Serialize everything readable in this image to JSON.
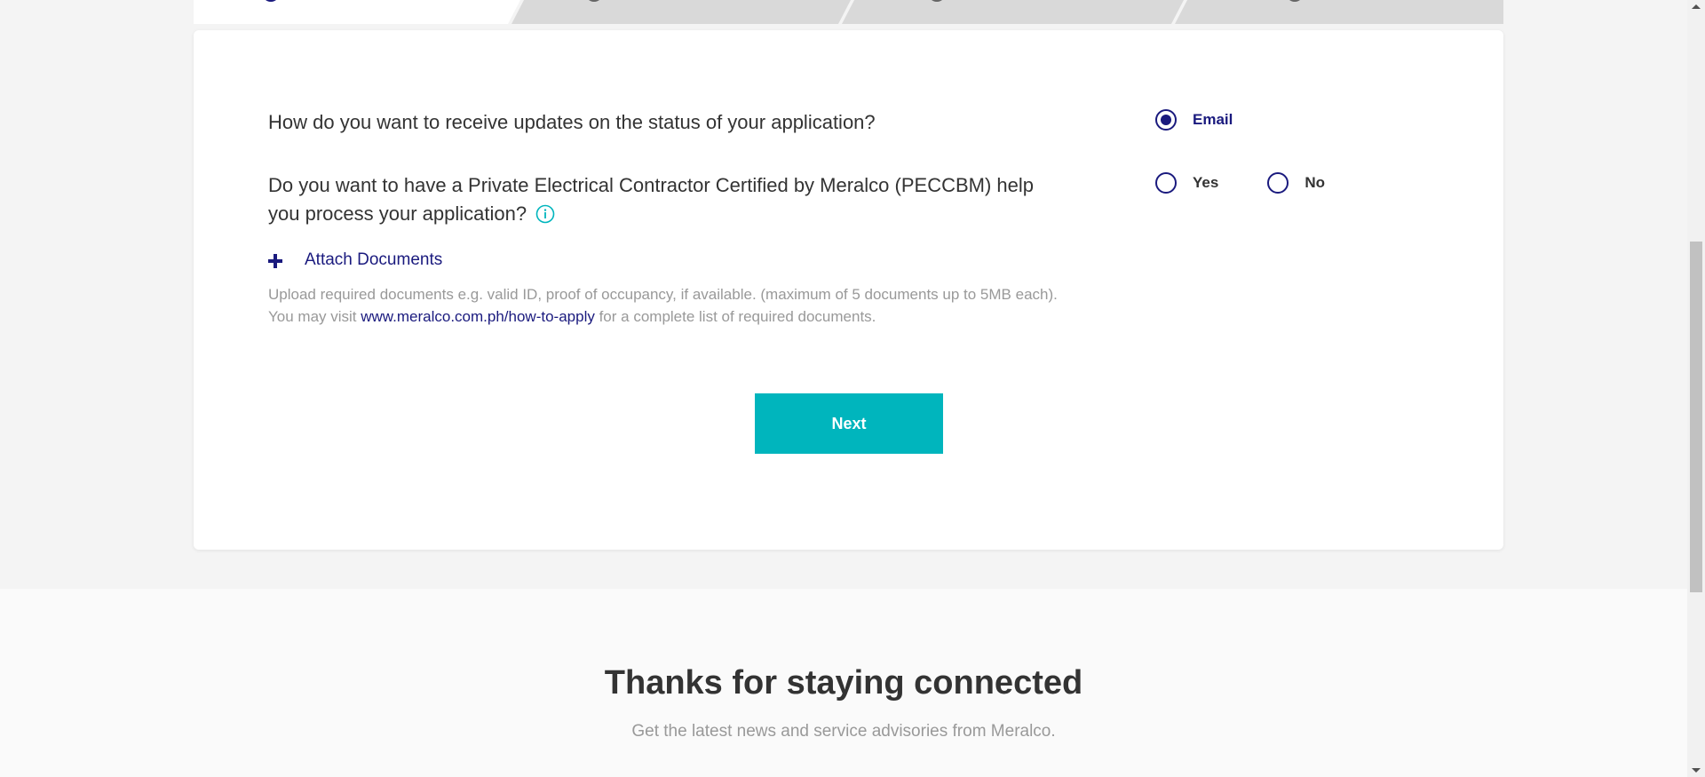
{
  "form": {
    "update_question": "How do you want to receive updates on the status of your application?",
    "update_options": [
      {
        "label": "Email",
        "selected": true
      }
    ],
    "peccbm_question": "Do you want to have a Private Electrical Contractor Certified by Meralco (PECCBM) help you process your application?",
    "peccbm_options": [
      {
        "label": "Yes",
        "selected": false
      },
      {
        "label": "No",
        "selected": false
      }
    ],
    "attach_label": "Attach Documents",
    "help_line1": "Upload required documents e.g. valid ID, proof of occupancy, if available. (maximum of 5 documents up to 5MB each).",
    "help_line2_prefix": "You may visit ",
    "help_link": "www.meralco.com.ph/how-to-apply",
    "help_line2_suffix": " for a complete list of required documents.",
    "next_label": "Next"
  },
  "footer": {
    "heading": "Thanks for staying connected",
    "subheading": "Get the latest news and service advisories from Meralco."
  },
  "colors": {
    "brand_navy": "#1a1a7e",
    "accent_teal": "#00b5bd"
  },
  "icons": {
    "info": "info-icon",
    "attach": "plus-icon"
  }
}
